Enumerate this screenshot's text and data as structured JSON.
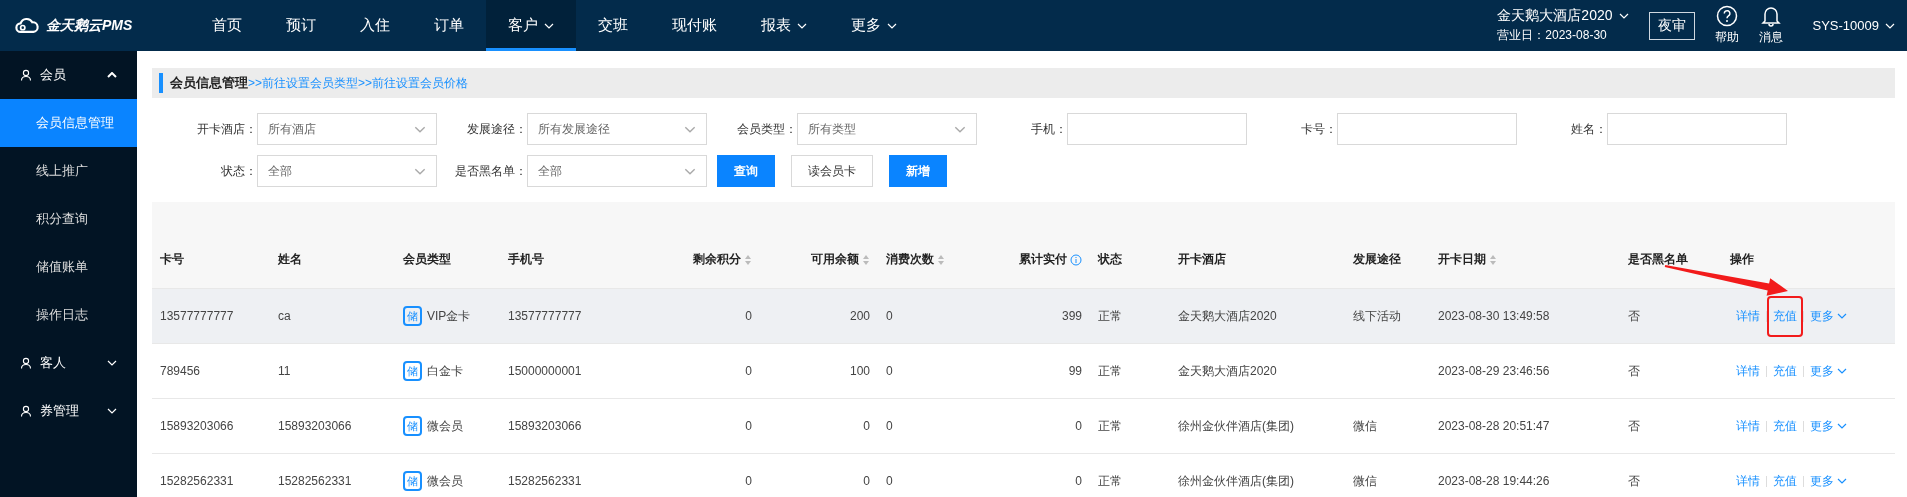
{
  "header": {
    "logo": "金天鹅云PMS",
    "nav": [
      {
        "label": "首页",
        "selected": false,
        "dropdown": false
      },
      {
        "label": "预订",
        "selected": false,
        "dropdown": false
      },
      {
        "label": "入住",
        "selected": false,
        "dropdown": false
      },
      {
        "label": "订单",
        "selected": false,
        "dropdown": false
      },
      {
        "label": "客户",
        "selected": true,
        "dropdown": true
      },
      {
        "label": "交班",
        "selected": false,
        "dropdown": false
      },
      {
        "label": "现付账",
        "selected": false,
        "dropdown": false
      },
      {
        "label": "报表",
        "selected": false,
        "dropdown": true
      },
      {
        "label": "更多",
        "selected": false,
        "dropdown": true
      }
    ],
    "hotel": "金天鹅大酒店2020",
    "business_day": "营业日：2023-08-30",
    "night_audit": "夜审",
    "help": "帮助",
    "messages": "消息",
    "user": "SYS-10009"
  },
  "sidebar": [
    {
      "label": "会员",
      "expanded": true,
      "children": [
        {
          "label": "会员信息管理",
          "selected": true
        },
        {
          "label": "线上推广",
          "selected": false
        },
        {
          "label": "积分查询",
          "selected": false
        },
        {
          "label": "储值账单",
          "selected": false
        },
        {
          "label": "操作日志",
          "selected": false
        }
      ]
    },
    {
      "label": "客人",
      "expanded": false
    },
    {
      "label": "券管理",
      "expanded": false
    }
  ],
  "page": {
    "title": "会员信息管理",
    "links": [
      ">>前往设置会员类型",
      ">>前往设置会员价格"
    ]
  },
  "filters": [
    {
      "label": "开卡酒店：",
      "kind": "select",
      "value": "所有酒店"
    },
    {
      "label": "发展途径：",
      "kind": "select",
      "value": "所有发展途径"
    },
    {
      "label": "会员类型：",
      "kind": "select",
      "value": "所有类型"
    },
    {
      "label": "手机：",
      "kind": "input"
    },
    {
      "label": "卡号：",
      "kind": "input"
    },
    {
      "label": "姓名：",
      "kind": "input"
    },
    {
      "label": "状态：",
      "kind": "select",
      "value": "全部"
    },
    {
      "label": "是否黑名单：",
      "kind": "select",
      "value": "全部"
    }
  ],
  "buttons": [
    {
      "label": "查询",
      "kind": "primary"
    },
    {
      "label": "读会员卡",
      "kind": "default"
    },
    {
      "label": "新增",
      "kind": "primary"
    }
  ],
  "table": {
    "columns": [
      {
        "label": "卡号",
        "kind": "text",
        "sortable": false,
        "info": false
      },
      {
        "label": "姓名",
        "kind": "text",
        "sortable": false,
        "info": false
      },
      {
        "label": "会员类型",
        "kind": "text",
        "sortable": false,
        "info": false
      },
      {
        "label": "手机号",
        "kind": "text",
        "sortable": false,
        "info": false
      },
      {
        "label": "剩余积分",
        "kind": "number",
        "sortable": true,
        "info": false
      },
      {
        "label": "可用余额",
        "kind": "number",
        "sortable": true,
        "info": false
      },
      {
        "label": "消费次数",
        "kind": "text",
        "sortable": true,
        "info": false
      },
      {
        "label": "累计实付",
        "kind": "number",
        "sortable": false,
        "info": true
      },
      {
        "label": "状态",
        "kind": "text",
        "sortable": false,
        "info": false
      },
      {
        "label": "开卡酒店",
        "kind": "text",
        "sortable": false,
        "info": false
      },
      {
        "label": "发展途径",
        "kind": "text",
        "sortable": false,
        "info": false
      },
      {
        "label": "开卡日期",
        "kind": "text",
        "sortable": true,
        "info": false
      },
      {
        "label": "是否黑名单",
        "kind": "text",
        "sortable": false,
        "info": false
      },
      {
        "label": "操作",
        "kind": "text",
        "sortable": false,
        "info": false
      }
    ],
    "rows": [
      {
        "hovered": true,
        "card_no": "13577777777",
        "name": "ca",
        "badge": "储",
        "member_type": "VIP金卡",
        "phone": "13577777777",
        "points": "0",
        "balance": "200",
        "visits": "0",
        "total_paid": "399",
        "status": "正常",
        "hotel": "金天鹅大酒店2020",
        "channel": "线下活动",
        "open_date": "2023-08-30 13:49:58",
        "blacklisted": "否",
        "actions": [
          {
            "label": "详情",
            "highlighted": false,
            "dropdown": false
          },
          {
            "label": "充值",
            "highlighted": true,
            "dropdown": false
          },
          {
            "label": "更多",
            "highlighted": false,
            "dropdown": true
          }
        ]
      },
      {
        "hovered": false,
        "card_no": "789456",
        "name": "11",
        "badge": "储",
        "member_type": "白金卡",
        "phone": "15000000001",
        "points": "0",
        "balance": "100",
        "visits": "0",
        "total_paid": "99",
        "status": "正常",
        "hotel": "金天鹅大酒店2020",
        "open_date": "2023-08-29 23:46:56",
        "blacklisted": "否",
        "actions": [
          {
            "label": "详情",
            "highlighted": false,
            "dropdown": false
          },
          {
            "label": "充值",
            "highlighted": false,
            "dropdown": false
          },
          {
            "label": "更多",
            "highlighted": false,
            "dropdown": true
          }
        ]
      },
      {
        "hovered": false,
        "card_no": "15893203066",
        "name": "15893203066",
        "badge": "储",
        "member_type": "微会员",
        "phone": "15893203066",
        "points": "0",
        "balance": "0",
        "visits": "0",
        "total_paid": "0",
        "status": "正常",
        "hotel": "徐州金伙伴酒店(集团)",
        "channel": "微信",
        "open_date": "2023-08-28 20:51:47",
        "blacklisted": "否",
        "actions": [
          {
            "label": "详情",
            "highlighted": false,
            "dropdown": false
          },
          {
            "label": "充值",
            "highlighted": false,
            "dropdown": false
          },
          {
            "label": "更多",
            "highlighted": false,
            "dropdown": true
          }
        ]
      },
      {
        "hovered": false,
        "card_no": "15282562331",
        "name": "15282562331",
        "badge": "储",
        "member_type": "微会员",
        "phone": "15282562331",
        "points": "0",
        "balance": "0",
        "visits": "0",
        "total_paid": "0",
        "status": "正常",
        "hotel": "徐州金伙伴酒店(集团)",
        "channel": "微信",
        "open_date": "2023-08-28 19:44:26",
        "blacklisted": "否",
        "actions": [
          {
            "label": "详情",
            "highlighted": false,
            "dropdown": false
          },
          {
            "label": "充值",
            "highlighted": false,
            "dropdown": false
          },
          {
            "label": "更多",
            "highlighted": false,
            "dropdown": true
          }
        ]
      }
    ]
  }
}
